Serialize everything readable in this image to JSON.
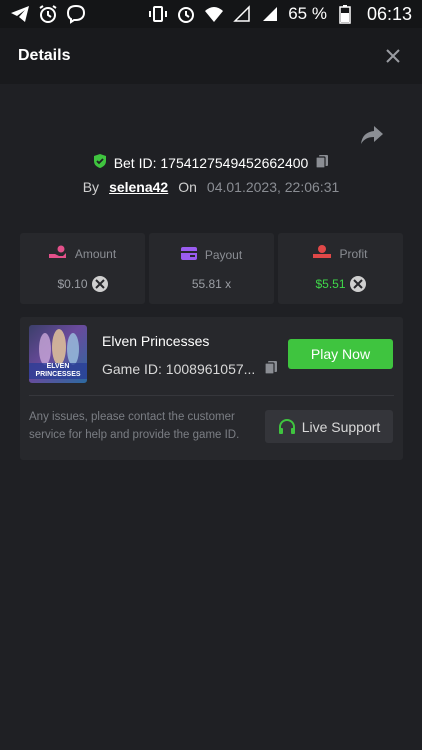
{
  "status_bar": {
    "battery": "65 %",
    "time": "06:13",
    "left_icons": [
      "telegram-icon",
      "alarm-icon",
      "viber-icon"
    ],
    "right_icons": [
      "vibrate-icon",
      "alarm-icon",
      "wifi-icon",
      "signal-empty-icon",
      "signal-icon",
      "battery-icon"
    ]
  },
  "header": {
    "title": "Details"
  },
  "bet": {
    "id_label": "Bet ID: 1754127549452662400",
    "by_label": "By",
    "user": "selena42",
    "on_label": "On",
    "date": "04.01.2023, 22:06:31"
  },
  "stats": [
    {
      "label": "Amount",
      "value": "$0.10",
      "icon": "coins-hand-icon",
      "color": "#e3508a"
    },
    {
      "label": "Payout",
      "value": "55.81 x",
      "icon": "card-icon",
      "color": "#9a5cf0"
    },
    {
      "label": "Profit",
      "value": "$5.51",
      "icon": "profit-icon",
      "color": "#e04848"
    }
  ],
  "game": {
    "name": "Elven Princesses",
    "id_label": "Game ID: 1008961057...",
    "thumb_text": "ELVEN PRINCESSES",
    "play_label": "Play Now",
    "issue_text": "Any issues, please contact the customer service for help and provide the game ID.",
    "support_label": "Live Support"
  },
  "colors": {
    "accent_green": "#3fc43f",
    "background": "#1f2024",
    "card": "#27282c"
  }
}
